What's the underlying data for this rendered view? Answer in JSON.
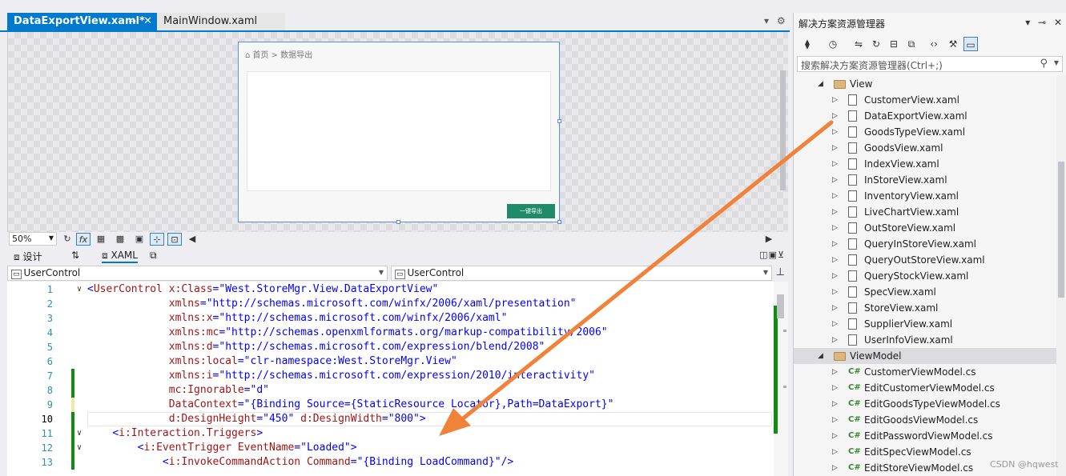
{
  "tabs": {
    "active": {
      "label": "DataExportView.xaml*"
    },
    "inactive": {
      "label": "MainWindow.xaml"
    }
  },
  "designer": {
    "breadcrumb": "首页 > 数据导出",
    "export_button": "一键导出"
  },
  "zoom": {
    "value": "50%"
  },
  "split": {
    "design_label": "设计",
    "xaml_label": "XAML"
  },
  "combos": {
    "left": "UserControl",
    "right": "UserControl"
  },
  "editor": {
    "line_numbers": [
      "1",
      "2",
      "3",
      "4",
      "5",
      "6",
      "7",
      "8",
      "9",
      "10",
      "11",
      "12",
      "13"
    ],
    "lines": [
      "<UserControl x:Class=\"West.StoreMgr.View.DataExportView\"",
      "             xmlns=\"http://schemas.microsoft.com/winfx/2006/xaml/presentation\"",
      "             xmlns:x=\"http://schemas.microsoft.com/winfx/2006/xaml\"",
      "             xmlns:mc=\"http://schemas.openxmlformats.org/markup-compatibility/2006\"",
      "             xmlns:d=\"http://schemas.microsoft.com/expression/blend/2008\"",
      "             xmlns:local=\"clr-namespace:West.StoreMgr.View\"",
      "             xmlns:i=\"http://schemas.microsoft.com/expression/2010/interactivity\"",
      "             mc:Ignorable=\"d\"",
      "             DataContext=\"{Binding Source={StaticResource Locator},Path=DataExport}\"",
      "             d:DesignHeight=\"450\" d:DesignWidth=\"800\">",
      "    <i:Interaction.Triggers>",
      "        <i:EventTrigger EventName=\"Loaded\">",
      "            <i:InvokeCommandAction Command=\"{Binding LoadCommand}\"/>"
    ]
  },
  "solution": {
    "title": "解决方案资源管理器",
    "search_placeholder": "搜索解决方案资源管理器(Ctrl+;)",
    "view_folder": "View",
    "view_files": [
      "CustomerView.xaml",
      "DataExportView.xaml",
      "GoodsTypeView.xaml",
      "GoodsView.xaml",
      "IndexView.xaml",
      "InStoreView.xaml",
      "InventoryView.xaml",
      "LiveChartView.xaml",
      "OutStoreView.xaml",
      "QueryInStoreView.xaml",
      "QueryOutStoreView.xaml",
      "QueryStockView.xaml",
      "SpecView.xaml",
      "StoreView.xaml",
      "SupplierView.xaml",
      "UserInfoView.xaml"
    ],
    "viewmodel_folder": "ViewModel",
    "viewmodel_files": [
      "CustomerViewModel.cs",
      "EditCustomerViewModel.cs",
      "EditGoodsTypeViewModel.cs",
      "EditGoodsViewModel.cs",
      "EditPasswordViewModel.cs",
      "EditSpecViewModel.cs",
      "EditStoreViewModel.cs"
    ],
    "cs_badge": "C#"
  },
  "watermark": "CSDN @hqwest",
  "colors": {
    "accent": "#007acc",
    "annotation_arrow": "#f0823a",
    "export_button": "#1f8b6a"
  }
}
